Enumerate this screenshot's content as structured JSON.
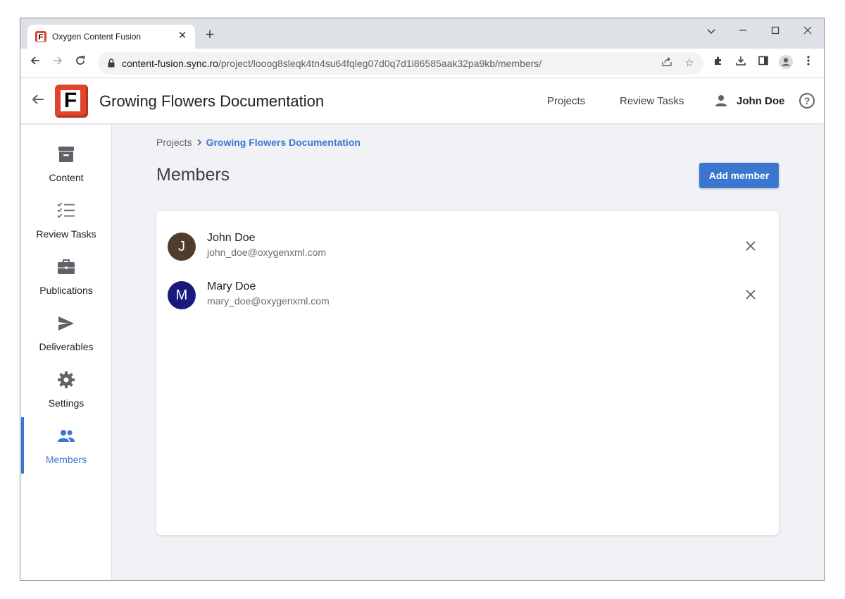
{
  "browser": {
    "tab_title": "Oxygen Content Fusion",
    "tab_favicon_letter": "F",
    "url_host": "content-fusion.sync.ro",
    "url_path": "/project/looog8sleqk4tn4su64fqleg07d0q7d1i86585aak32pa9kb/members/"
  },
  "app": {
    "logo_letter": "F",
    "title": "Growing Flowers Documentation",
    "nav": {
      "projects": "Projects",
      "review_tasks": "Review Tasks"
    },
    "user_name": "John Doe",
    "help_glyph": "?"
  },
  "sidebar": {
    "items": [
      {
        "label": "Content",
        "icon": "archive-icon"
      },
      {
        "label": "Review Tasks",
        "icon": "checklist-icon"
      },
      {
        "label": "Publications",
        "icon": "briefcase-icon"
      },
      {
        "label": "Deliverables",
        "icon": "send-icon"
      },
      {
        "label": "Settings",
        "icon": "gear-icon"
      },
      {
        "label": "Members",
        "icon": "people-icon",
        "active": true
      }
    ]
  },
  "main": {
    "breadcrumb": {
      "root": "Projects",
      "current": "Growing Flowers Documentation"
    },
    "title": "Members",
    "add_button": "Add member",
    "members": [
      {
        "initial": "J",
        "name": "John Doe",
        "email": "john_doe@oxygenxml.com",
        "color": "#4e3d2c"
      },
      {
        "initial": "M",
        "name": "Mary Doe",
        "email": "mary_doe@oxygenxml.com",
        "color": "#1a1a7e"
      }
    ]
  },
  "colors": {
    "accent": "#3b77d0",
    "logo": "#e0442c"
  }
}
